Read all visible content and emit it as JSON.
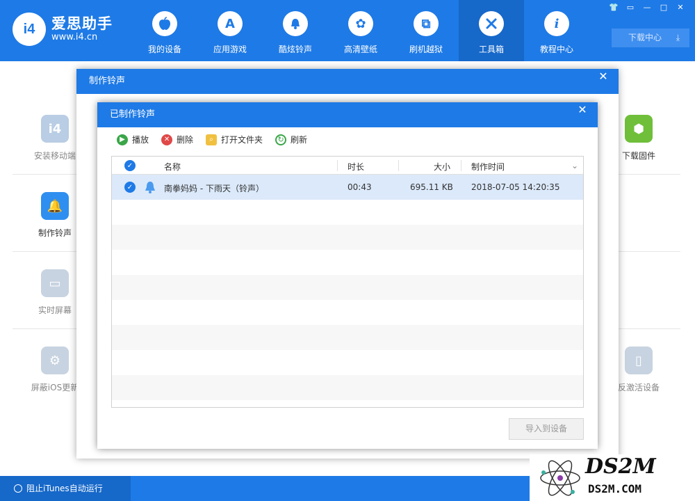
{
  "app": {
    "name": "爱思助手",
    "url": "www.i4.cn",
    "badge": "i4"
  },
  "nav": [
    {
      "label": "我的设备",
      "icon": "apple-icon",
      "glyph": ""
    },
    {
      "label": "应用游戏",
      "icon": "app-store-icon",
      "glyph": "A"
    },
    {
      "label": "酷炫铃声",
      "icon": "bell-icon",
      "glyph": "🔔"
    },
    {
      "label": "高清壁纸",
      "icon": "flower-icon",
      "glyph": "✿"
    },
    {
      "label": "刷机越狱",
      "icon": "dropbox-icon",
      "glyph": "⧉"
    },
    {
      "label": "工具箱",
      "icon": "tools-icon",
      "glyph": "✕"
    },
    {
      "label": "教程中心",
      "icon": "info-icon",
      "glyph": "i"
    }
  ],
  "active_nav": "工具箱",
  "window_controls": [
    "👕",
    "▭",
    "—",
    "□",
    "✕"
  ],
  "download_center": "下载中心",
  "background_tools": {
    "left": [
      "安装移动端",
      "制作铃声",
      "实时屏幕",
      "屏蔽iOS更新"
    ],
    "right": [
      "下载固件",
      "反激活设备"
    ]
  },
  "bottom": {
    "itunes_label": "阻止iTunes自动运行"
  },
  "outer_dialog": {
    "title": "制作铃声",
    "close": "✕"
  },
  "inner_dialog": {
    "title": "已制作铃声",
    "close": "✕",
    "toolbar": {
      "play": "播放",
      "delete": "删除",
      "open_folder": "打开文件夹",
      "refresh": "刷新"
    },
    "columns": {
      "name": "名称",
      "duration": "时长",
      "size": "大小",
      "time": "制作时间"
    },
    "rows": [
      {
        "name": "南拳妈妈 - 下雨天（铃声）",
        "duration": "00:43",
        "size": "695.11 KB",
        "time": "2018-07-05 14:20:35",
        "checked": true
      }
    ],
    "import_button": "导入到设备"
  },
  "watermark": {
    "big": "DS2M",
    "small": "DS2M.COM"
  },
  "colors": {
    "primary": "#1e7ae6",
    "primary_dark": "#1668c9",
    "selected_row": "#dbe9fa"
  }
}
